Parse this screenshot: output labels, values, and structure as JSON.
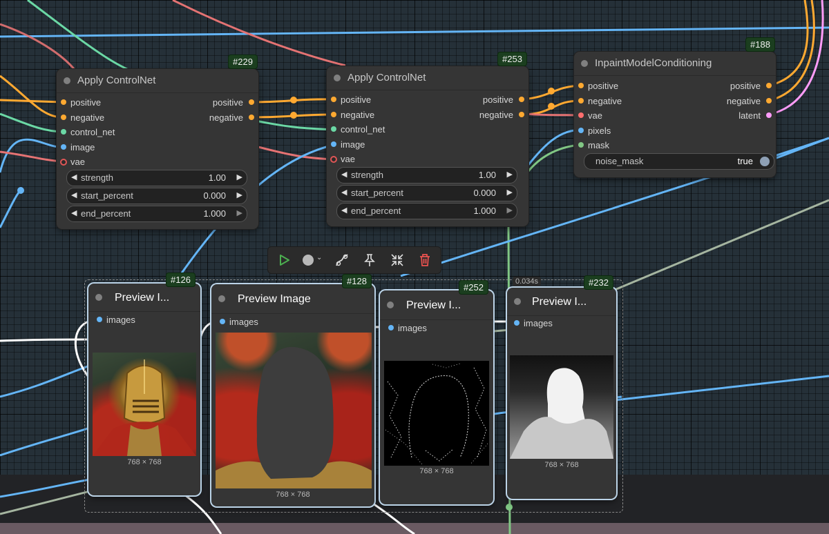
{
  "nodes": {
    "n229": {
      "badge": "#229",
      "title": "Apply ControlNet",
      "inputs": [
        "positive",
        "negative",
        "control_net",
        "image",
        "vae"
      ],
      "outputs": [
        "positive",
        "negative"
      ],
      "widgets": [
        {
          "label": "strength",
          "value": "1.00"
        },
        {
          "label": "start_percent",
          "value": "0.000"
        },
        {
          "label": "end_percent",
          "value": "1.000"
        }
      ]
    },
    "n253": {
      "badge": "#253",
      "title": "Apply ControlNet",
      "inputs": [
        "positive",
        "negative",
        "control_net",
        "image",
        "vae"
      ],
      "outputs": [
        "positive",
        "negative"
      ],
      "widgets": [
        {
          "label": "strength",
          "value": "1.00"
        },
        {
          "label": "start_percent",
          "value": "0.000"
        },
        {
          "label": "end_percent",
          "value": "1.000"
        }
      ]
    },
    "n188": {
      "badge": "#188",
      "title": "InpaintModelConditioning",
      "inputs": [
        "positive",
        "negative",
        "vae",
        "pixels",
        "mask"
      ],
      "outputs": [
        "positive",
        "negative",
        "latent"
      ],
      "widget": {
        "label": "noise_mask",
        "value": "true"
      }
    },
    "n126": {
      "badge": "#126",
      "title": "Preview I...",
      "input": "images",
      "size": "768 × 768"
    },
    "n128": {
      "badge": "#128",
      "title": "Preview Image",
      "input": "images",
      "size": "768 × 768"
    },
    "n252": {
      "badge": "#252",
      "title": "Preview I...",
      "input": "images",
      "size": "768 × 768"
    },
    "n232": {
      "badge": "#232",
      "title": "Preview I...",
      "input": "images",
      "size": "768 × 768",
      "timing": "0.034s"
    }
  },
  "toolbar": {
    "buttons": [
      "play-icon",
      "color-picker-icon",
      "bypass-icon",
      "pin-icon",
      "fit-icon",
      "delete-icon"
    ]
  },
  "colors": {
    "conditioning": "#ffa931",
    "control_net": "#6bd8a5",
    "image": "#64b5f6",
    "vae": "#ff6e6e",
    "latent": "#ff9cf9",
    "mask": "#81c784"
  }
}
